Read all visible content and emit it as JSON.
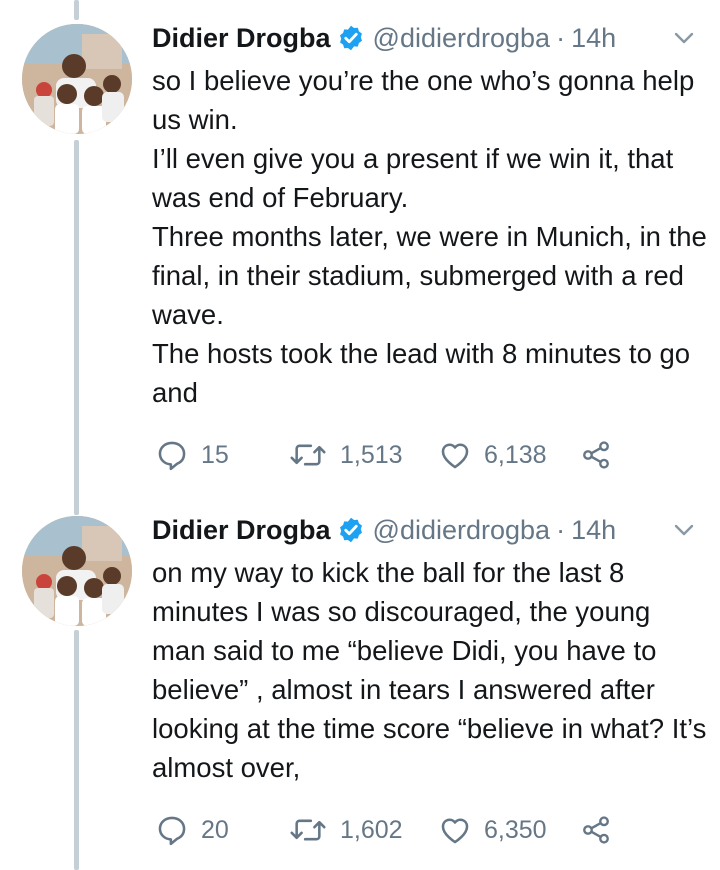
{
  "tweets": [
    {
      "author": {
        "name": "Didier Drogba",
        "handle": "@didierdrogba",
        "separator": "·",
        "time": "14h",
        "verified": true
      },
      "lines": [
        "so I believe you’re the one who’s gonna help us win.",
        "I’ll even give you a present if we win it, that was end of February.",
        "Three months later, we were in Munich, in the final, in their stadium, submerged with a red wave.",
        "The hosts took the lead with 8 minutes to go and"
      ],
      "replies": "15",
      "retweets": "1,513",
      "likes": "6,138"
    },
    {
      "author": {
        "name": "Didier Drogba",
        "handle": "@didierdrogba",
        "separator": "·",
        "time": "14h",
        "verified": true
      },
      "lines": [
        "on my way to kick the ball for the last 8 minutes I was so discouraged, the young man said to me “believe Didi, you have to believe” , almost in tears I answered after looking at the time score “believe in what? It’s almost over,"
      ],
      "replies": "20",
      "retweets": "1,602",
      "likes": "6,350"
    }
  ],
  "icons": {
    "reply": "reply-icon",
    "retweet": "retweet-icon",
    "like": "heart-icon",
    "share": "share-icon",
    "verified": "verified-badge-icon",
    "menu": "chevron-down-icon"
  },
  "colors": {
    "text": "#14171a",
    "muted": "#657786",
    "verified": "#1da1f2",
    "thread_line": "#c4cfd6"
  }
}
